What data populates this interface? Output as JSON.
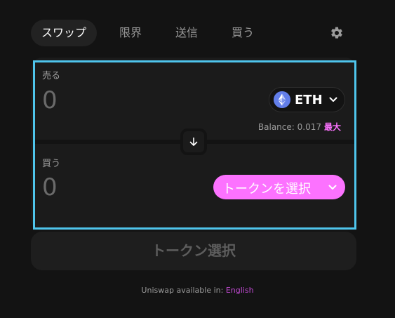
{
  "tabs": {
    "swap": "スワップ",
    "limit": "限界",
    "send": "送信",
    "buy": "買う"
  },
  "sell": {
    "label": "売る",
    "amount_placeholder": "0",
    "token": "ETH",
    "balance_label": "Balance: 0.017",
    "max_label": "最大"
  },
  "buy": {
    "label": "買う",
    "amount_placeholder": "0",
    "select_token_label": "トークンを選択"
  },
  "cta": {
    "label": "トークン選択"
  },
  "footer": {
    "text": "Uniswap available in:",
    "language_link": "English"
  },
  "icons": {
    "settings": "gear-icon",
    "eth_logo": "eth-logo-icon",
    "switch": "arrow-down-icon",
    "dropdown": "chevron-down-icon"
  },
  "colors": {
    "background": "#131313",
    "card": "#1b1b1b",
    "accent_pink": "#fc72ff",
    "eth_blue": "#627eea",
    "focus_ring": "#4fc5ec"
  }
}
